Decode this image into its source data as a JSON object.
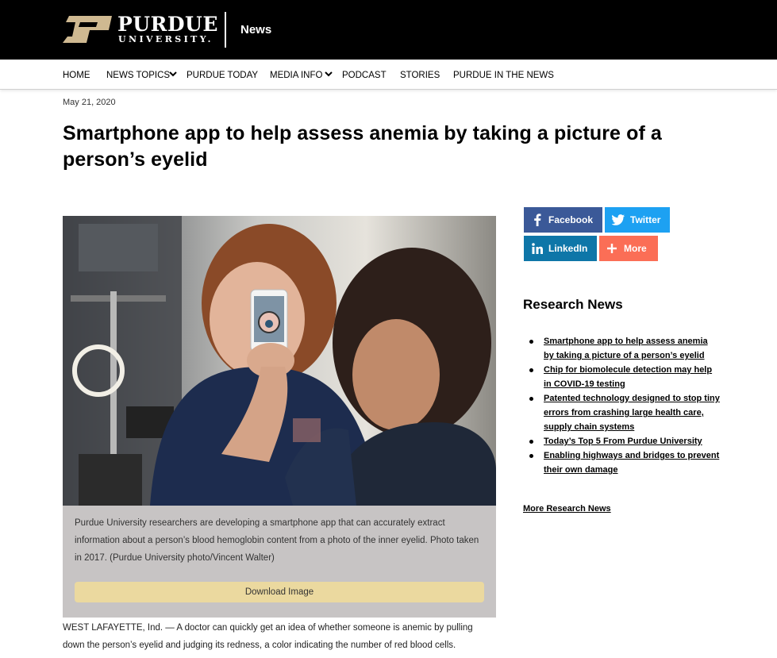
{
  "header": {
    "logo_main": "PURDUE",
    "logo_sub": "UNIVERSITY.",
    "section": "News"
  },
  "nav": {
    "items": [
      {
        "label": "HOME"
      },
      {
        "label": "NEWS TOPICS"
      },
      {
        "label": "PURDUE TODAY"
      },
      {
        "label": "MEDIA INFO"
      },
      {
        "label": "PODCAST"
      },
      {
        "label": "STORIES"
      },
      {
        "label": "PURDUE IN THE NEWS"
      }
    ]
  },
  "article": {
    "date": "May 21, 2020",
    "title": "Smartphone app to help assess anemia by taking a picture of a person’s eyelid",
    "caption": "Purdue University researchers are developing a smartphone app that can accurately extract information about a person’s blood hemoglobin content from a photo of the inner eyelid. Photo taken in 2017. (Purdue University photo/Vincent Walter)",
    "download_label": "Download Image",
    "body_start": "WEST LAFAYETTE, Ind. — A doctor can quickly get an idea of whether someone is anemic by pulling down the person’s eyelid and judging its redness, a color indicating the number of red blood cells."
  },
  "share": {
    "facebook": "Facebook",
    "twitter": "Twitter",
    "linkedin": "LinkedIn",
    "more": "More"
  },
  "research_news": {
    "title": "Research News",
    "items": [
      {
        "label": "Smartphone app to help assess anemia by taking a picture of a person’s eyelid"
      },
      {
        "label": "Chip for biomolecule detection may help in COVID-19 testing"
      },
      {
        "label": "Patented technology designed to stop tiny errors from crashing large health care, supply chain systems"
      },
      {
        "label": "Today’s Top 5 From Purdue University"
      },
      {
        "label": "Enabling highways and bridges to prevent their own damage"
      }
    ],
    "more_link": "More Research News"
  },
  "colors": {
    "gold": "#CFB991",
    "facebook": "#3b5998",
    "twitter": "#1da1f2",
    "linkedin": "#0e76a8",
    "more": "#fb6e56",
    "caption_bg": "#c7c4c4",
    "download_bg": "#ebd99f"
  }
}
